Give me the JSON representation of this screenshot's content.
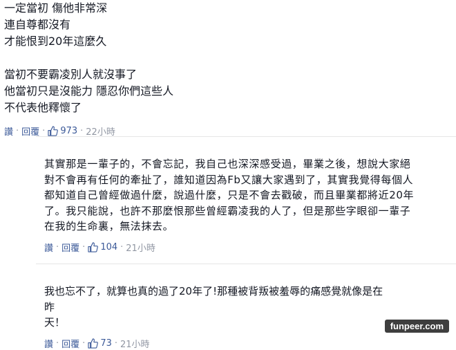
{
  "comments": [
    {
      "text": "一定當初 傷他非常深\n連自尊都沒有\n才能恨到20年這麼久\n\n當初不要霸凌別人就沒事了\n他當初只是沒能力 隱忍你們這些人\n不代表他釋懷了",
      "actions": {
        "reply_label": "讚",
        "reply2_label": "回覆",
        "likes": "973",
        "time": "22小時"
      }
    },
    {
      "text": "其實那是一輩子的，不會忘記，我自己也深深感受過，畢業之後，想說大家絕\n對不會再有任何的牽扯了，誰知道因為Fb又讓大家遇到了，其實我覺得每個人\n都知道自己曾經做過什麼，說過什麼，只是不會去戳破，而且畢業都將近20年\n了。我只能說，也許不那麼恨那些曾經霸凌我的人了，但是那些字眼卻一輩子\n在我的生命裏，無法抹去。",
      "actions": {
        "reply_label": "讚",
        "reply2_label": "回覆",
        "likes": "104",
        "time": "21小時"
      }
    },
    {
      "text": "我也忘不了，就算也真的過了20年了!那種被背叛被羞辱的痛感覺就像是在昨\n天！",
      "actions": {
        "reply_label": "讚",
        "reply2_label": "回覆",
        "likes": "73",
        "time": "21小時"
      }
    }
  ],
  "dot": "·",
  "watermark": "funpeer.com",
  "colors": {
    "link": "#3b5998",
    "meta": "#9197a3",
    "text": "#141823"
  },
  "icons": {
    "like": "thumbs-up-icon"
  }
}
